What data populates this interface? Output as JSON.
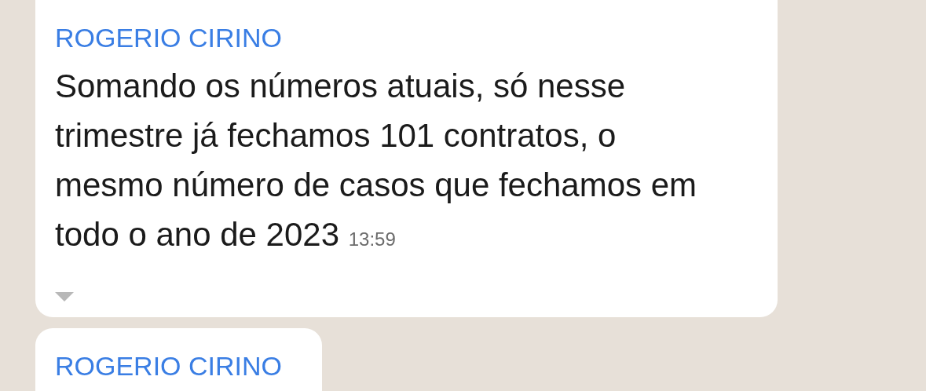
{
  "messages": [
    {
      "sender": "ROGERIO CIRINO",
      "text": "Somando os números atuais, só nesse trimestre já fechamos 101 contratos, o mesmo número de casos que fechamos em todo o ano de 2023",
      "time": "13:59"
    },
    {
      "sender": "ROGERIO CIRINO"
    }
  ]
}
